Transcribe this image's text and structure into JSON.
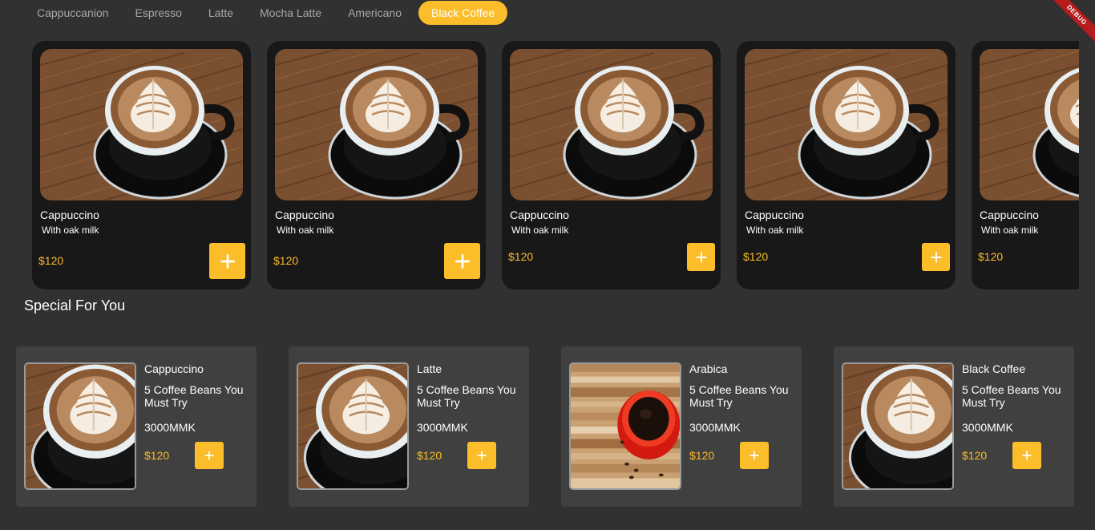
{
  "tabs": [
    "Cappuccanion",
    "Espresso",
    "Latte",
    "Mocha Latte",
    "Americano",
    "Black Coffee"
  ],
  "active_tab": "Black Coffee",
  "debug_banner": "DEBUG",
  "products": [
    {
      "name": "Cappuccino",
      "subtitle": "With oak milk",
      "price": "$120"
    },
    {
      "name": "Cappuccino",
      "subtitle": "With oak milk",
      "price": "$120"
    },
    {
      "name": "Cappuccino",
      "subtitle": "With oak milk",
      "price": "$120"
    },
    {
      "name": "Cappuccino",
      "subtitle": "With oak milk",
      "price": "$120"
    },
    {
      "name": "Cappuccino",
      "subtitle": "With oak milk",
      "price": "$120"
    }
  ],
  "special_section": {
    "title": "Special For You",
    "items": [
      {
        "name": "Cappuccino",
        "description": "5 Coffee Beans You Must Try",
        "amount": "3000MMK",
        "price": "$120",
        "image": "latte-art-cup"
      },
      {
        "name": "Latte",
        "description": "5 Coffee Beans You Must Try",
        "amount": "3000MMK",
        "price": "$120",
        "image": "latte-art-cup"
      },
      {
        "name": "Arabica",
        "description": "5 Coffee Beans You Must Try",
        "amount": "3000MMK",
        "price": "$120",
        "image": "red-cup-black-coffee"
      },
      {
        "name": "Black Coffee",
        "description": "5 Coffee Beans You Must Try",
        "amount": "3000MMK",
        "price": "$120",
        "image": "latte-art-cup"
      }
    ]
  },
  "icons": {
    "add": "plus-icon"
  },
  "colors": {
    "accent": "#fbbd29",
    "background": "#313131",
    "card": "#181818",
    "special_card": "#404040"
  }
}
